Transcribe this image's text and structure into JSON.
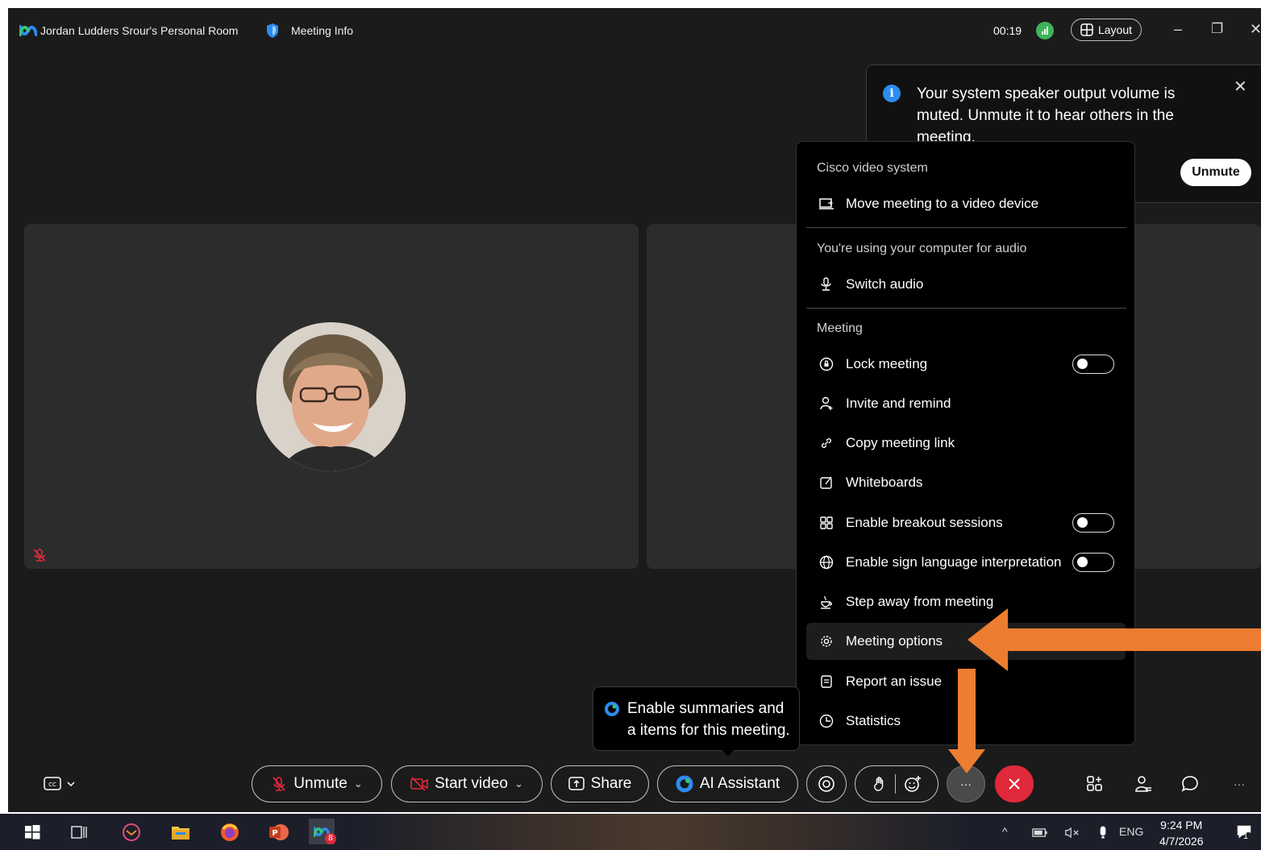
{
  "titlebar": {
    "room_name": "Jordan Ludders Srour's Personal Room",
    "meeting_info": "Meeting Info",
    "elapsed": "00:19",
    "layout_label": "Layout",
    "minimize": "–",
    "restore": "❐",
    "close": "✕"
  },
  "toast": {
    "message": "Your system speaker output volume is muted. Unmute it to hear others in the meeting.",
    "info_glyph": "i",
    "close_glyph": "✕",
    "unmute_label": "Unmute"
  },
  "menu": {
    "section_video": "Cisco video system",
    "move_meeting": "Move meeting to a video device",
    "section_audio": "You're using your computer for audio",
    "switch_audio": "Switch audio",
    "section_meeting": "Meeting",
    "items": [
      {
        "label": "Lock meeting",
        "icon": "lock-icon",
        "toggle": false
      },
      {
        "label": "Invite and remind",
        "icon": "invite-icon"
      },
      {
        "label": "Copy meeting link",
        "icon": "link-icon"
      },
      {
        "label": "Whiteboards",
        "icon": "whiteboard-icon"
      },
      {
        "label": "Enable breakout sessions",
        "icon": "breakout-icon",
        "toggle": false
      },
      {
        "label": "Enable sign language interpretation",
        "icon": "globe-icon",
        "toggle": false
      },
      {
        "label": "Step away from meeting",
        "icon": "coffee-icon"
      },
      {
        "label": "Meeting options",
        "icon": "gear-icon",
        "highlighted": true
      },
      {
        "label": "Report an issue",
        "icon": "report-icon"
      },
      {
        "label": "Statistics",
        "icon": "statistics-icon"
      }
    ]
  },
  "ai_tooltip": {
    "text": "Enable summaries and action items for this meeting.",
    "text_visible": "Enable summaries and a items for this meeting."
  },
  "controls": {
    "unmute": "Unmute",
    "start_video": "Start video",
    "share": "Share",
    "ai_assistant": "AI Assistant",
    "more": "···"
  },
  "taskbar": {
    "time": "9:24 PM",
    "date": "4/7/2026",
    "language": "ENG",
    "webex_badge": "8",
    "notification_badge": "1"
  },
  "colors": {
    "app_bg": "#1b1b1b",
    "tile_bg": "#2c2c2c",
    "menu_bg": "#000000",
    "end_call": "#e0293b",
    "annotation_arrow": "#ed7d31",
    "signal": "#3fb35b",
    "info_blue": "#2d8cf0"
  }
}
